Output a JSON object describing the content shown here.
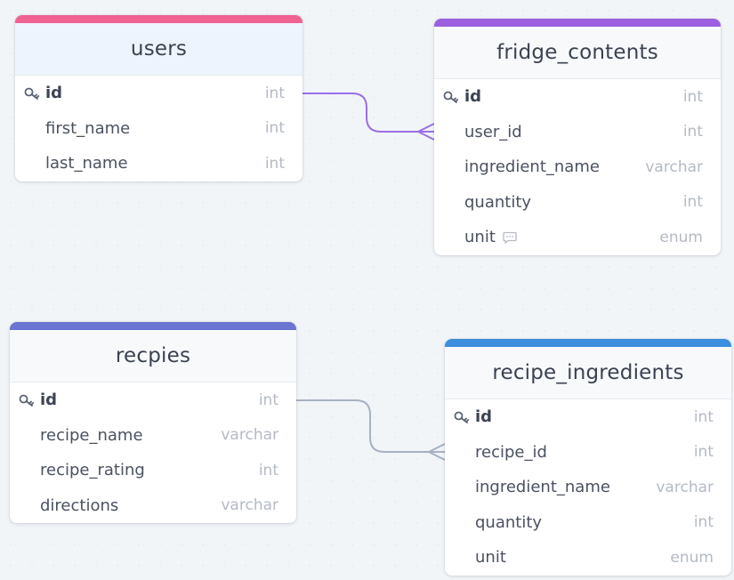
{
  "colors": {
    "users": "#f06292",
    "fridge_contents": "#9c5fe0",
    "recpies": "#6b74d0",
    "recipe_ingredients": "#3b8fdc",
    "link_purple": "#9c6ee8",
    "link_gray": "#a7b1c2"
  },
  "icons": {
    "primary_key": "key-icon",
    "note": "comment-icon"
  },
  "tables": {
    "users": {
      "name": "users",
      "fields": [
        {
          "name": "id",
          "type": "int",
          "pk": true
        },
        {
          "name": "first_name",
          "type": "int"
        },
        {
          "name": "last_name",
          "type": "int"
        }
      ]
    },
    "fridge_contents": {
      "name": "fridge_contents",
      "fields": [
        {
          "name": "id",
          "type": "int",
          "pk": true
        },
        {
          "name": "user_id",
          "type": "int"
        },
        {
          "name": "ingredient_name",
          "type": "varchar"
        },
        {
          "name": "quantity",
          "type": "int"
        },
        {
          "name": "unit",
          "type": "enum",
          "note": true
        }
      ]
    },
    "recpies": {
      "name": "recpies",
      "fields": [
        {
          "name": "id",
          "type": "int",
          "pk": true
        },
        {
          "name": "recipe_name",
          "type": "varchar"
        },
        {
          "name": "recipe_rating",
          "type": "int"
        },
        {
          "name": "directions",
          "type": "varchar"
        }
      ]
    },
    "recipe_ingredients": {
      "name": "recipe_ingredients",
      "fields": [
        {
          "name": "id",
          "type": "int",
          "pk": true
        },
        {
          "name": "recipe_id",
          "type": "int"
        },
        {
          "name": "ingredient_name",
          "type": "varchar"
        },
        {
          "name": "quantity",
          "type": "int"
        },
        {
          "name": "unit",
          "type": "enum"
        }
      ]
    }
  },
  "relations": [
    {
      "from": "users.id",
      "to": "fridge_contents.user_id",
      "cardinality": "one-to-many"
    },
    {
      "from": "recpies.id",
      "to": "recipe_ingredients.recipe_id",
      "cardinality": "one-to-many"
    }
  ]
}
